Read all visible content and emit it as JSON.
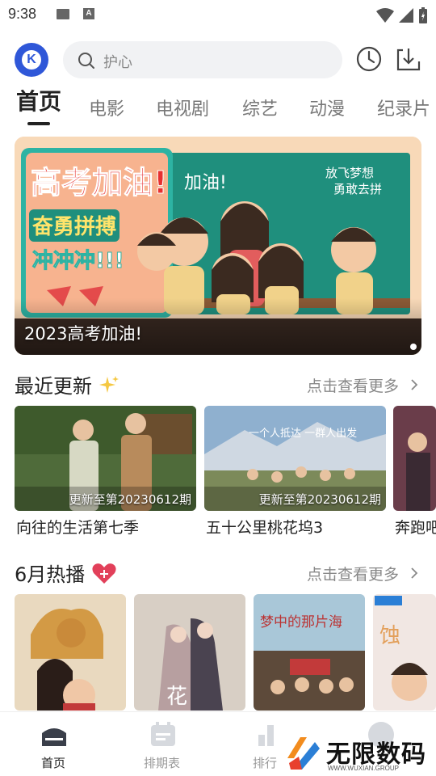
{
  "status_bar": {
    "time": "9:38",
    "a_icon_letter": "A"
  },
  "header": {
    "logo_letter": "K",
    "search_placeholder": "护心"
  },
  "tabs": [
    {
      "label": "首页",
      "active": true
    },
    {
      "label": "电影",
      "active": false
    },
    {
      "label": "电视剧",
      "active": false
    },
    {
      "label": "综艺",
      "active": false
    },
    {
      "label": "动漫",
      "active": false
    },
    {
      "label": "纪录片",
      "active": false
    }
  ],
  "banner": {
    "caption": "2023高考加油!",
    "poster_text": {
      "headline": "高考加油!",
      "line2": "奋勇拼搏",
      "line3": "冲冲冲!!!",
      "board": "加油!",
      "side": "放飞梦想",
      "side2": "勇敢去拼"
    }
  },
  "recent": {
    "title": "最近更新",
    "more": "点击查看更多",
    "cards": [
      {
        "title": "向往的生活第七季",
        "update": "更新至第20230612期",
        "thumb_text": ""
      },
      {
        "title": "五十公里桃花坞3",
        "update": "更新至第20230612期",
        "thumb_text": "一个人抵达 一群人出发"
      },
      {
        "title": "奔跑吧",
        "update": "",
        "thumb_text": ""
      }
    ]
  },
  "hot": {
    "title": "6月热播",
    "more": "点击查看更多",
    "posters": [
      {
        "text": ""
      },
      {
        "text": "花"
      },
      {
        "text": "梦中的那片海"
      },
      {
        "text": ""
      }
    ]
  },
  "bottom_nav": [
    {
      "label": "首页",
      "active": true
    },
    {
      "label": "排期表",
      "active": false
    },
    {
      "label": "排行",
      "active": false
    }
  ],
  "watermark": {
    "text": "无限数码",
    "sub": "WWW.WUXIAN.GROUP"
  },
  "colors": {
    "accent": "#2f57d8",
    "text": "#222222",
    "muted": "#888888"
  }
}
